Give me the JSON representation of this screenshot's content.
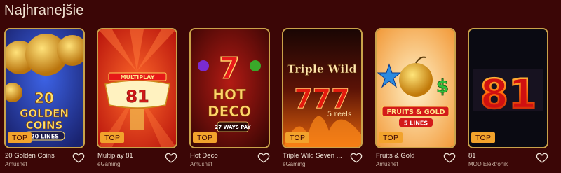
{
  "section": {
    "title": "Najhranejšie"
  },
  "badge_label": "TOP",
  "games": [
    {
      "name": "20 Golden Coins",
      "provider": "Amusnet",
      "art": {
        "line1": "20",
        "line2": "GOLDEN",
        "line3": "COINS",
        "line4": "20 LINES"
      }
    },
    {
      "name": "Multiplay 81",
      "provider": "eGaming",
      "art": {
        "line1": "MULTIPLAY",
        "line2": "81"
      }
    },
    {
      "name": "Hot Deco",
      "provider": "Amusnet",
      "art": {
        "line1": "7",
        "line2": "HOT",
        "line3": "DECO",
        "line4": "27 WAYS PAY"
      }
    },
    {
      "name": "Triple Wild Seven ...",
      "provider": "eGaming",
      "art": {
        "line1": "Triple Wild",
        "line2": "777",
        "line3": "5 reels"
      }
    },
    {
      "name": "Fruits & Gold",
      "provider": "Amusnet",
      "art": {
        "line1": "FRUITS & GOLD",
        "line2": "5 LINES"
      }
    },
    {
      "name": "81",
      "provider": "MOD Elektronik",
      "art": {
        "line1": "81"
      }
    }
  ],
  "colors": {
    "background": "#3b0606",
    "border": "#c9a24a",
    "badge": "#f2a32c"
  },
  "icons": {
    "favorite": "heart-outline-icon"
  }
}
